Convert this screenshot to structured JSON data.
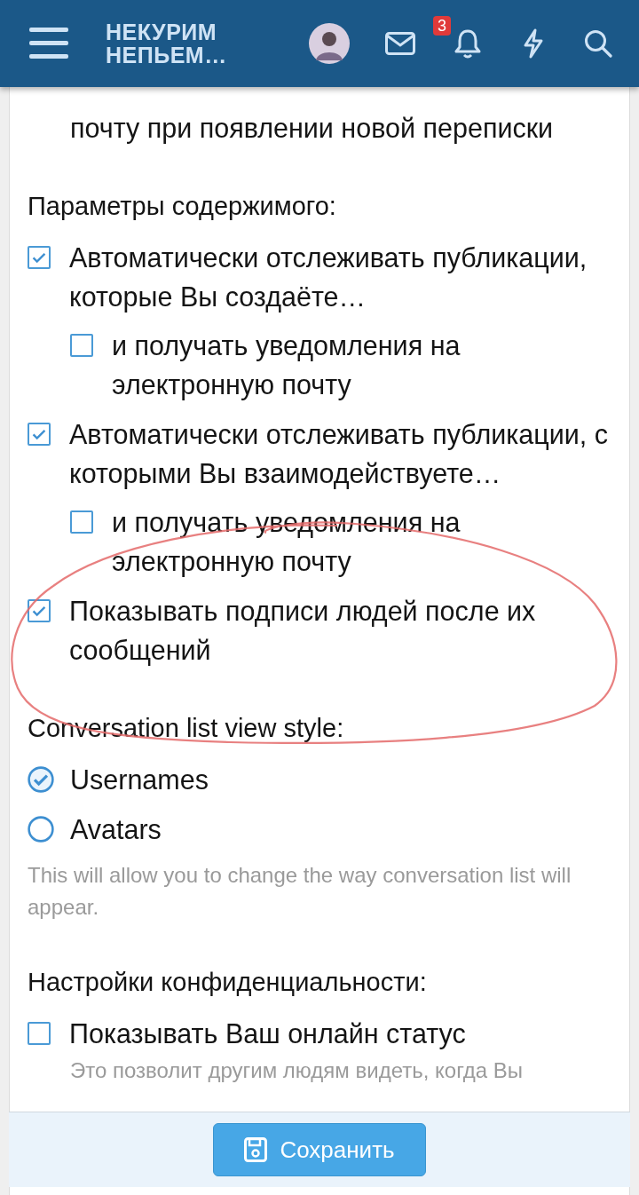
{
  "header": {
    "logo_lines": [
      "НЕКУРИМ",
      "НЕПЬЕМ…"
    ],
    "notification_count": "3"
  },
  "sections": [
    {
      "options": [
        {
          "kind": "continuation",
          "label": "почту при появлении новой переписки"
        }
      ]
    },
    {
      "heading": "Параметры содержимого:",
      "options": [
        {
          "kind": "checkbox",
          "label": "Автоматически отслеживать публикации, которые Вы создаёте…",
          "checked": true,
          "children": [
            {
              "kind": "checkbox",
              "label": "и получать уведомления на электронную почту",
              "checked": false
            }
          ]
        },
        {
          "kind": "checkbox",
          "label": "Автоматически отслеживать публикации, с которыми Вы взаимодействуете…",
          "checked": true,
          "children": [
            {
              "kind": "checkbox",
              "label": "и получать уведомления на электронную почту",
              "checked": false
            }
          ]
        },
        {
          "kind": "checkbox",
          "label": "Показывать подписи людей после их сообщений",
          "checked": true
        }
      ]
    },
    {
      "heading": "Conversation list view style:",
      "options": [
        {
          "kind": "radio",
          "label": "Usernames",
          "selected": true
        },
        {
          "kind": "radio",
          "label": "Avatars",
          "selected": false
        }
      ],
      "hint": "This will allow you to change the way conversation list will appear."
    },
    {
      "heading": "Настройки конфиденциальности:",
      "options": [
        {
          "kind": "checkbox",
          "label": "Показывать Ваш онлайн статус",
          "checked": false,
          "hint": "Это позволит другим людям видеть, когда Вы"
        }
      ]
    }
  ],
  "save_button": "Сохранить"
}
